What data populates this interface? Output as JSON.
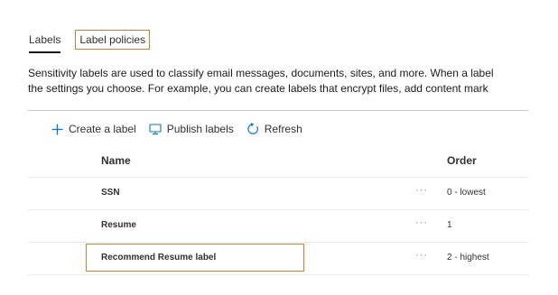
{
  "tabs": [
    {
      "label": "Labels",
      "active": true
    },
    {
      "label": "Label policies",
      "active": false
    }
  ],
  "description": {
    "line1": "Sensitivity labels are used to classify email messages, documents, sites, and more. When a label",
    "line2": "the settings you choose. For example, you can create labels that encrypt files, add content mark"
  },
  "toolbar": {
    "create_label": "Create a label",
    "publish_labels": "Publish labels",
    "refresh": "Refresh"
  },
  "table": {
    "columns": {
      "name": "Name",
      "order": "Order"
    },
    "rows": [
      {
        "name": "SSN",
        "more": "···",
        "order": "0 - lowest"
      },
      {
        "name": "Resume",
        "more": "···",
        "order": "1"
      },
      {
        "name": "Recommend Resume label",
        "more": "···",
        "order": "2 - highest"
      }
    ]
  },
  "colors": {
    "highlight": "#e07a2e",
    "accent": "#0078d4"
  },
  "icons": {
    "create": "plus-icon",
    "publish": "monitor-icon",
    "refresh": "refresh-icon"
  }
}
